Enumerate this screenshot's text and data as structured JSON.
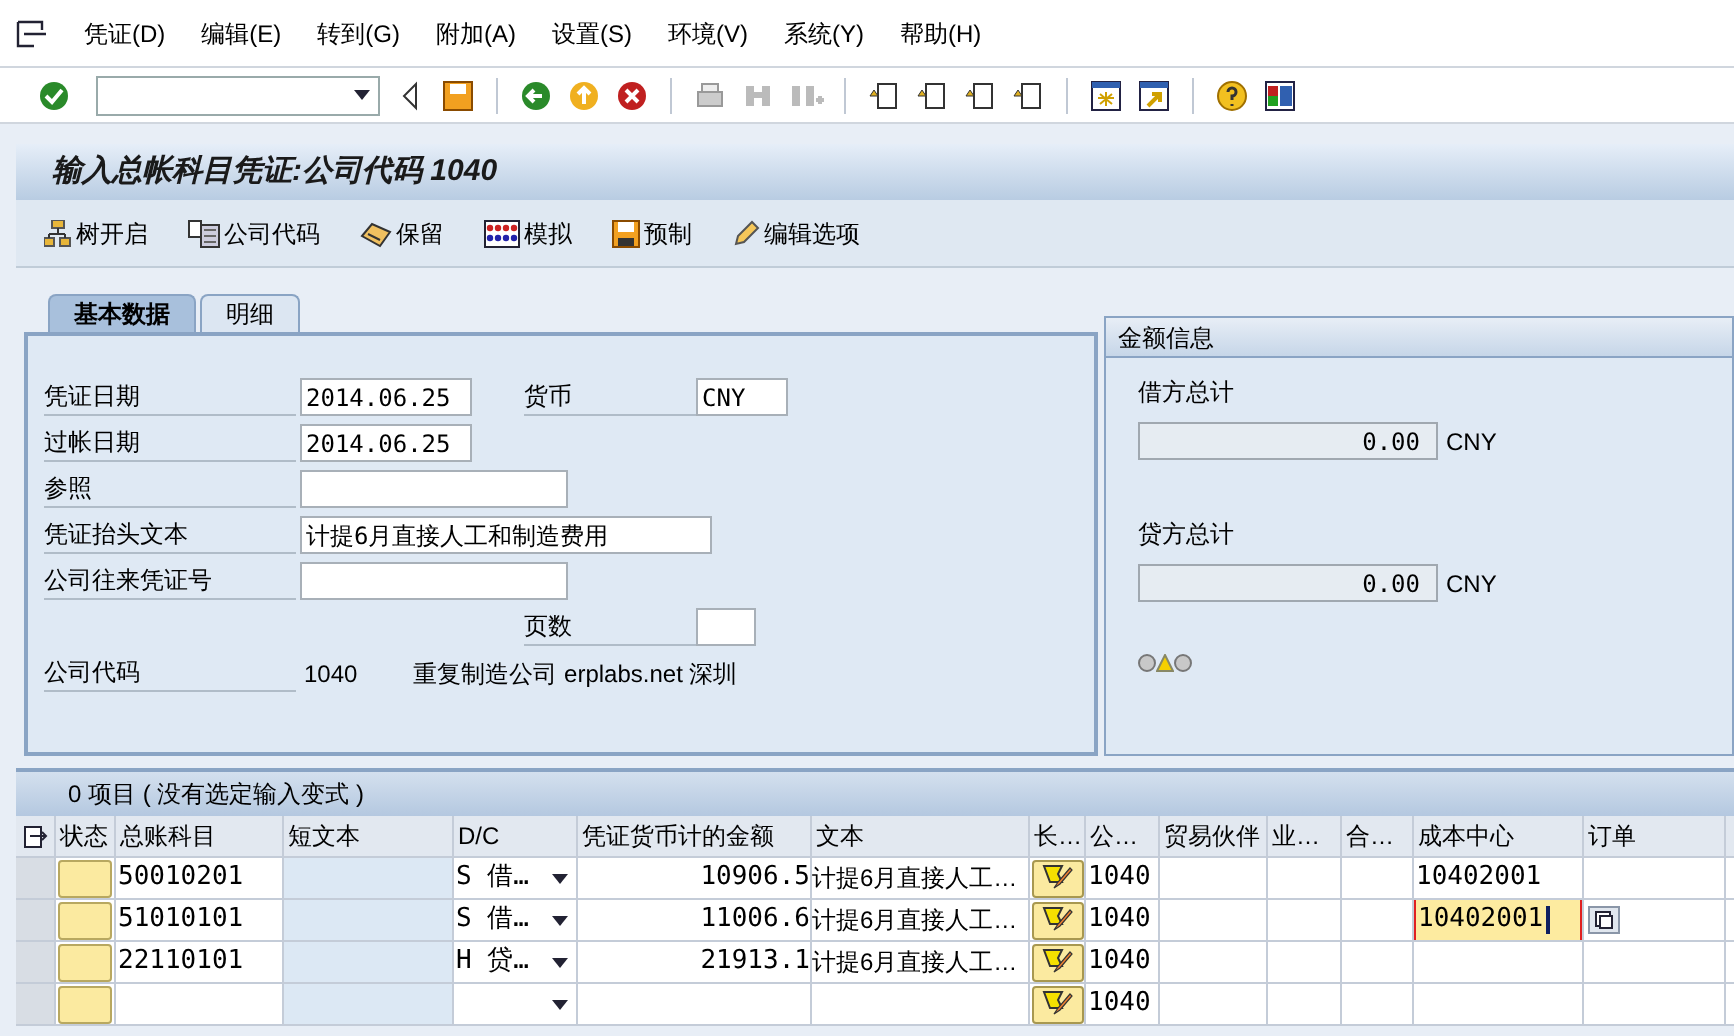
{
  "menu": [
    "凭证(D)",
    "编辑(E)",
    "转到(G)",
    "附加(A)",
    "设置(S)",
    "环境(V)",
    "系统(Y)",
    "帮助(H)"
  ],
  "title": "输入总帐科目凭证:公司代码 1040",
  "app_toolbar": [
    {
      "label": "树开启",
      "kind": "tree"
    },
    {
      "label": "公司代码",
      "kind": "company"
    },
    {
      "label": "保留",
      "kind": "hold"
    },
    {
      "label": "模拟",
      "kind": "simulate"
    },
    {
      "label": "预制",
      "kind": "park"
    },
    {
      "label": "编辑选项",
      "kind": "edit"
    }
  ],
  "tabs": [
    {
      "label": "基本数据",
      "selected": true
    },
    {
      "label": "明细",
      "selected": false
    }
  ],
  "header_rows": [
    {
      "label": "凭证日期",
      "value": "2014.06.25",
      "kind": "date",
      "side_label": "货币",
      "side_value": "CNY"
    },
    {
      "label": "过帐日期",
      "value": "2014.06.25",
      "kind": "date"
    },
    {
      "label": "参照",
      "kind": "medium"
    },
    {
      "label": "凭证抬头文本",
      "value": "计提6月直接人工和制造费用",
      "kind": "long"
    },
    {
      "label": "公司往来凭证号",
      "kind": "medium"
    },
    {
      "kind": "side_only",
      "side_label": "页数"
    },
    {
      "label": "公司代码",
      "value": "1040",
      "kind": "display",
      "description": "重复制造公司 erplabs.net 深圳"
    }
  ],
  "amount_panel": {
    "title": "金额信息",
    "totals": [
      {
        "label": "借方总计",
        "value": "0.00",
        "currency": "CNY"
      },
      {
        "label": "贷方总计",
        "value": "0.00",
        "currency": "CNY"
      }
    ],
    "lights": [
      {
        "on": false
      },
      {
        "on": true
      },
      {
        "on": false
      }
    ]
  },
  "table": {
    "title": "0 项目 ( 没有选定输入变式 )",
    "columns": [
      "状态",
      "总账科目",
      "短文本",
      "D/C",
      "凭证货币计的金额",
      "文本",
      "长…",
      "公…",
      "贸易伙伴",
      "业…",
      "合…",
      "成本中心",
      "订单"
    ],
    "rows": [
      {
        "account": "50010201",
        "dc": "S 借…",
        "amount": "10906.5",
        "text": "计提6月直接人工…",
        "company": "1040",
        "cost_center": "10402001",
        "focused": false
      },
      {
        "account": "51010101",
        "dc": "S 借…",
        "amount": "11006.6",
        "text": "计提6月直接人工…",
        "company": "1040",
        "cost_center": "10402001",
        "focused": true
      },
      {
        "account": "22110101",
        "dc": "H 贷…",
        "amount": "21913.1",
        "text": "计提6月直接人工…",
        "company": "1040",
        "focused": false
      },
      {
        "company": "1040",
        "focused": false
      }
    ]
  }
}
